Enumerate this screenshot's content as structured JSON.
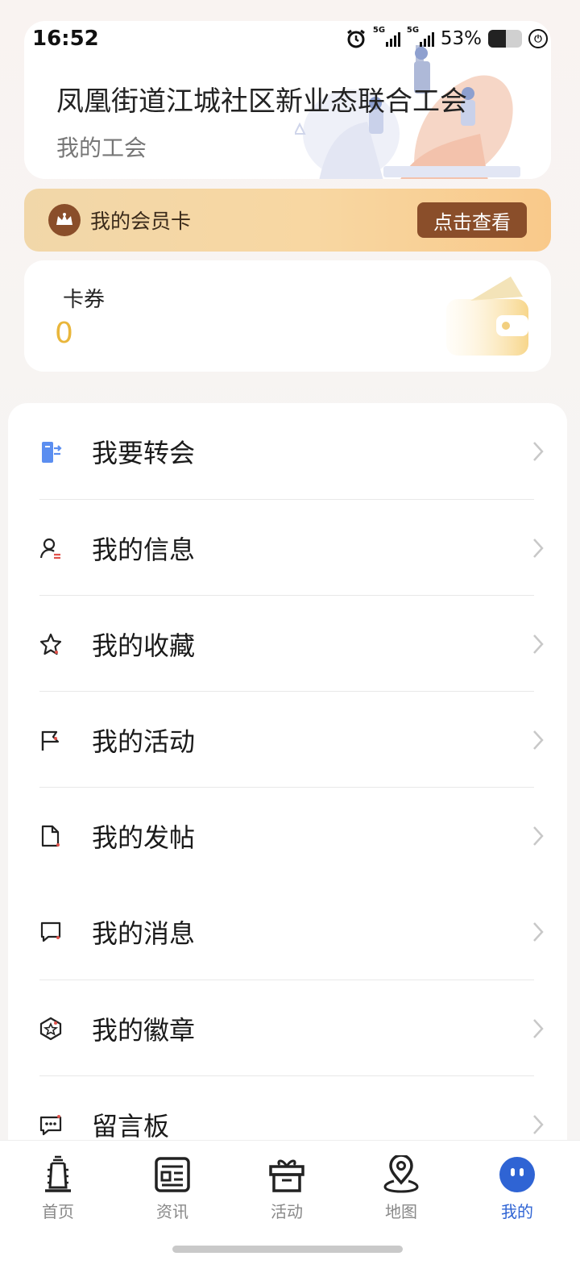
{
  "status_bar": {
    "time": "16:52",
    "signal1": "5G",
    "signal2": "5G",
    "battery": "53%"
  },
  "union": {
    "name": "凤凰街道江城社区新业态联合工会",
    "subtitle": "我的工会"
  },
  "member_card": {
    "label": "我的会员卡",
    "button": "点击查看"
  },
  "coupons": {
    "label": "卡券",
    "count": "0"
  },
  "menu": [
    {
      "label": "我要转会",
      "icon": "transfer-door-icon"
    },
    {
      "label": "我的信息",
      "icon": "user-info-icon"
    },
    {
      "label": "我的收藏",
      "icon": "star-icon"
    },
    {
      "label": "我的活动",
      "icon": "flag-icon"
    },
    {
      "label": "我的发帖",
      "icon": "document-icon"
    },
    {
      "label": "我的消息",
      "icon": "message-icon"
    },
    {
      "label": "我的徽章",
      "icon": "badge-icon"
    },
    {
      "label": "留言板",
      "icon": "comment-board-icon"
    }
  ],
  "bottom_nav": [
    {
      "label": "首页",
      "icon": "home-tower-icon",
      "active": false
    },
    {
      "label": "资讯",
      "icon": "news-icon",
      "active": false
    },
    {
      "label": "活动",
      "icon": "gift-icon",
      "active": false
    },
    {
      "label": "地图",
      "icon": "map-pin-icon",
      "active": false
    },
    {
      "label": "我的",
      "icon": "profile-face-icon",
      "active": true
    }
  ],
  "colors": {
    "accent": "#2f64d4",
    "member_button": "#8a4e2a",
    "coupon_count": "#e9b63b"
  }
}
